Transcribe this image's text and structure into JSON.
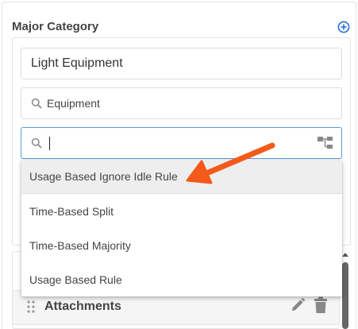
{
  "section": {
    "title": "Major Category",
    "add_icon": "plus-circle-icon"
  },
  "fields": {
    "name_value": "Light Equipment",
    "category_value": "Equipment",
    "category_icon": "search-icon",
    "search_value": "",
    "search_icon": "search-icon",
    "tree_icon": "hierarchy-icon"
  },
  "dropdown": {
    "options": [
      {
        "label": "Usage Based Ignore Idle Rule"
      },
      {
        "label": "Time-Based Split"
      },
      {
        "label": "Time-Based Majority"
      },
      {
        "label": "Usage Based Rule"
      }
    ]
  },
  "attachments": {
    "label": "Attachments",
    "grip_icon": "drag-handle-icon",
    "edit_icon": "pencil-icon",
    "delete_icon": "trash-icon"
  },
  "annotation": {
    "color": "#f35a1a"
  },
  "colors": {
    "accent": "#2a6fd6",
    "focus_border": "#5b9bd5"
  }
}
